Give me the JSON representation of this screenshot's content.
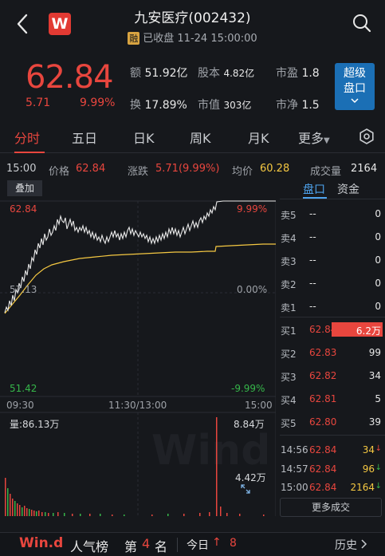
{
  "header": {
    "title": "九安医疗(002432)",
    "margin_badge": "融",
    "status": "已收盘 11-24 15:00:00",
    "logo_text": "W"
  },
  "quote": {
    "price": "62.84",
    "change": "5.71",
    "change_pct": "9.99%",
    "amount_label": "额",
    "amount": "51.92亿",
    "equity_label": "股本",
    "equity": "4.82亿",
    "pe_label": "市盈",
    "pe": "1.8",
    "turnover_label": "换",
    "turnover": "17.89%",
    "mktcap_label": "市值",
    "mktcap": "303亿",
    "pb_label": "市净",
    "pb": "1.5",
    "super_button": [
      "超级",
      "盘口"
    ]
  },
  "tabs": [
    "分时",
    "五日",
    "日K",
    "周K",
    "月K",
    "更多"
  ],
  "info": {
    "time": "15:00",
    "price_label": "价格",
    "price": "62.84",
    "chg_label": "涨跌",
    "chg": "5.71(9.99%)",
    "avg_label": "均价",
    "avg": "60.28",
    "vol_label": "成交量",
    "vol": "2164"
  },
  "chart": {
    "overlay_label": "叠加",
    "top_price": "62.84",
    "top_pct": "9.99%",
    "mid_price": "57.13",
    "mid_pct": "0.00%",
    "bot_price": "51.42",
    "bot_pct": "-9.99%",
    "time_start": "09:30",
    "time_mid": "11:30/13:00",
    "time_end": "15:00",
    "vol_label": "量:86.13万",
    "vol_max": "8.84万",
    "vol_mid": "4.42万",
    "watermark": "Wind"
  },
  "orderbook": {
    "tab_active": "盘口",
    "tab_other": "资金",
    "asks": [
      {
        "label": "卖5",
        "price": "--",
        "vol": "0"
      },
      {
        "label": "卖4",
        "price": "--",
        "vol": "0"
      },
      {
        "label": "卖3",
        "price": "--",
        "vol": "0"
      },
      {
        "label": "卖2",
        "price": "--",
        "vol": "0"
      },
      {
        "label": "卖1",
        "price": "--",
        "vol": "0"
      }
    ],
    "bids": [
      {
        "label": "买1",
        "price": "62.84",
        "vol": "6.2万"
      },
      {
        "label": "买2",
        "price": "62.83",
        "vol": "99"
      },
      {
        "label": "买3",
        "price": "62.82",
        "vol": "34"
      },
      {
        "label": "买4",
        "price": "62.81",
        "vol": "5"
      },
      {
        "label": "买5",
        "price": "62.80",
        "vol": "39"
      }
    ],
    "trades": [
      {
        "time": "14:56",
        "price": "62.84",
        "vol": "34"
      },
      {
        "time": "14:57",
        "price": "62.84",
        "vol": "96"
      },
      {
        "time": "15:00",
        "price": "62.84",
        "vol": "2164"
      }
    ],
    "more_trades": "更多成交"
  },
  "footer": {
    "brand": "Win.d",
    "popularity": "人气榜",
    "rank_prefix": "第",
    "rank": "4",
    "rank_suffix": "名",
    "today": "今日",
    "today_change": "8",
    "history": "历史"
  },
  "colors": {
    "up": "#e8463e",
    "down": "#36b64a",
    "avg_line": "#f5c842",
    "accent_blue": "#1b6fb5"
  }
}
